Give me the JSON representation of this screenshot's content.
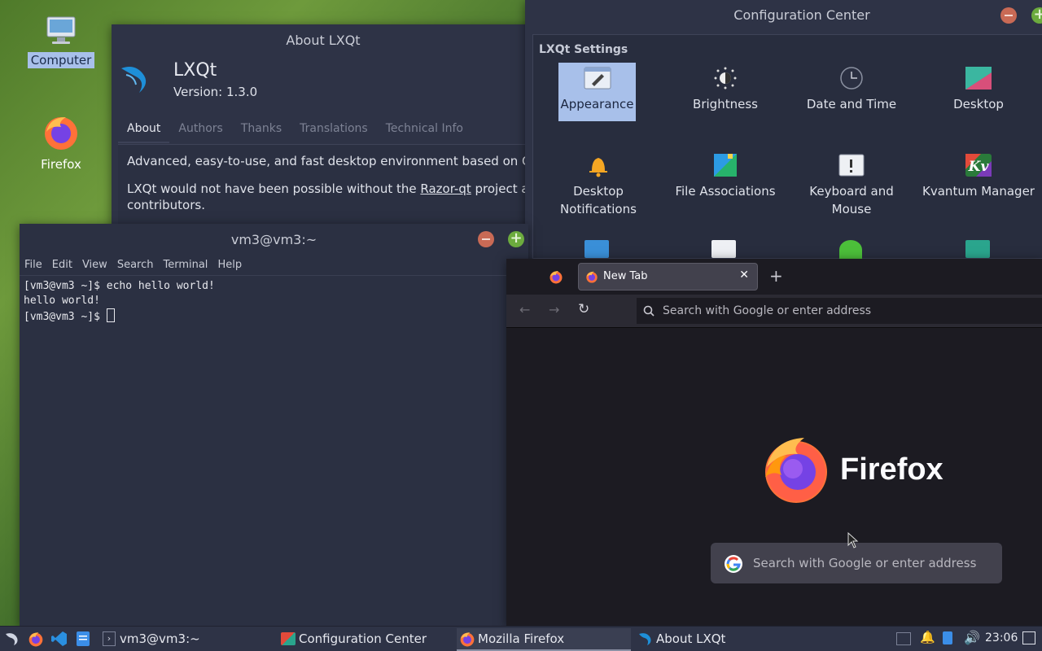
{
  "desktop": {
    "icons": [
      {
        "label": "Computer"
      },
      {
        "label": "Firefox"
      }
    ]
  },
  "about": {
    "title": "About LXQt",
    "app_name": "LXQt",
    "version": "Version: 1.3.0",
    "tabs": [
      "About",
      "Authors",
      "Thanks",
      "Translations",
      "Technical Info"
    ],
    "para1": "Advanced, easy-to-use, and fast desktop environment based on Qt tec",
    "para2_pre": "LXQt would not have been possible without the ",
    "para2_link": "Razor-qt",
    "para2_post": " project and it",
    "para2_line2": "contributors."
  },
  "config": {
    "title": "Configuration Center",
    "section": "LXQt Settings",
    "items": [
      {
        "label": "Appearance",
        "icon": "appearance-icon"
      },
      {
        "label": "Brightness",
        "icon": "brightness-icon"
      },
      {
        "label": "Date and Time",
        "icon": "clock-icon"
      },
      {
        "label": "Desktop",
        "icon": "desktop-icon"
      },
      {
        "label": "Desktop Notifications",
        "icon": "bell-icon"
      },
      {
        "label": "File Associations",
        "icon": "file-associations-icon"
      },
      {
        "label": "Keyboard and Mouse",
        "icon": "keyboard-icon"
      },
      {
        "label": "Kvantum Manager",
        "icon": "kvantum-icon"
      }
    ]
  },
  "terminal": {
    "title": "vm3@vm3:~",
    "menu": [
      "File",
      "Edit",
      "View",
      "Search",
      "Terminal",
      "Help"
    ],
    "lines": [
      "[vm3@vm3 ~]$ echo hello world!",
      "hello world!",
      "[vm3@vm3 ~]$ "
    ]
  },
  "firefox": {
    "tab_title": "New Tab",
    "new_tab_symbol": "+",
    "url_placeholder": "Search with Google or enter address",
    "brand": "Firefox",
    "search_placeholder": "Search with Google or enter address"
  },
  "taskbar": {
    "tasks": [
      {
        "label": "vm3@vm3:~"
      },
      {
        "label": "Configuration Center"
      },
      {
        "label": "Mozilla Firefox"
      },
      {
        "label": "About LXQt"
      }
    ],
    "clock": "23:06"
  },
  "colors": {
    "accent": "#a8c0ea",
    "panel": "#2e3346",
    "firefox_bg": "#1c1b22"
  }
}
